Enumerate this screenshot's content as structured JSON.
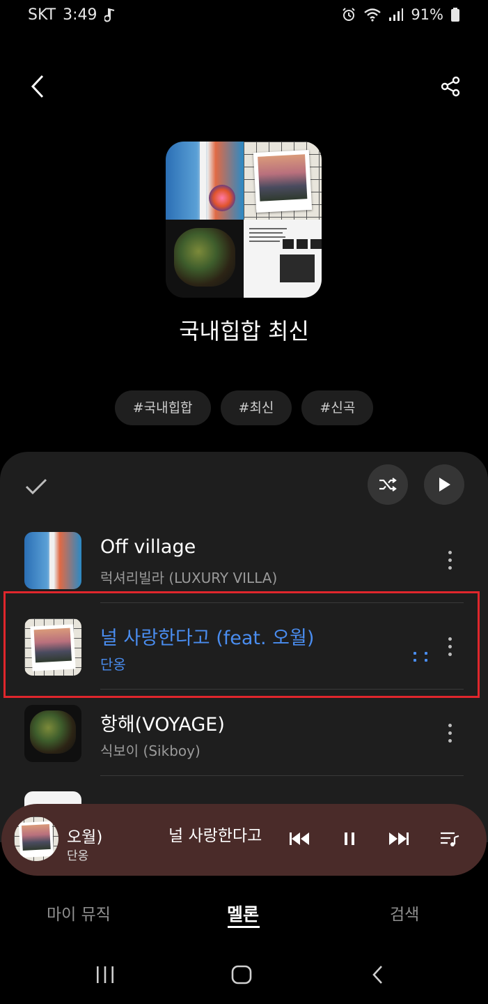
{
  "status_bar": {
    "carrier": "SKT",
    "time": "3:49",
    "battery": "91%"
  },
  "header": {
    "back_icon": "chevron-left-icon",
    "share_icon": "share-icon"
  },
  "playlist": {
    "title": "국내힙합 최신",
    "tags": [
      "#국내힙합",
      "#최신",
      "#신곡"
    ]
  },
  "controls": {
    "select_icon": "check-icon",
    "shuffle_icon": "shuffle-icon",
    "play_icon": "play-icon"
  },
  "tracks": [
    {
      "title": "Off village",
      "artist": "럭셔리빌라 (LUXURY VILLA)"
    },
    {
      "title": "널 사랑한다고 (feat. 오월)",
      "artist": "단옹",
      "playing": true
    },
    {
      "title": "항해(VOYAGE)",
      "artist": "식보이 (Sikboy)"
    }
  ],
  "mini_player": {
    "title_tail": "오월)",
    "title_head": "널 사랑한다고",
    "artist": "단옹"
  },
  "bottom_nav": {
    "tabs": [
      "마이 뮤직",
      "멜론",
      "검색"
    ],
    "active": "멜론"
  },
  "colors": {
    "accent": "#4a8df0",
    "mini_player_bg": "#4a2b29",
    "highlight_border": "#e0262c",
    "panel_bg": "#1e1e1e"
  }
}
